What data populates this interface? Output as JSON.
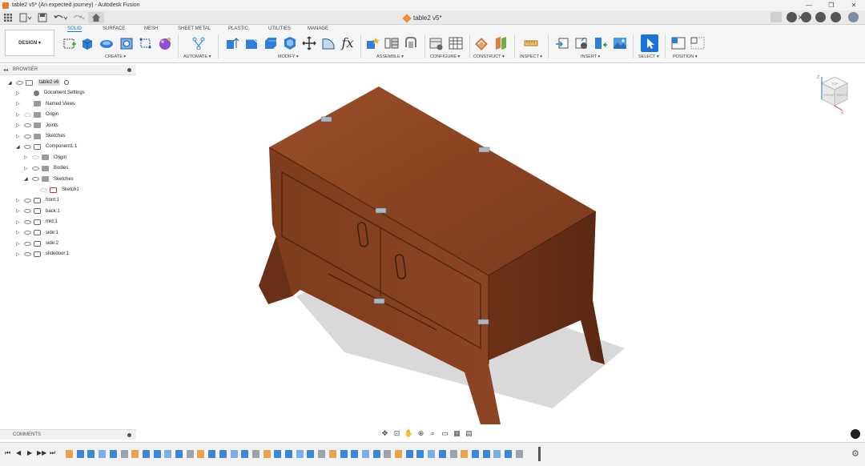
{
  "window": {
    "title": "table2 v5* (An expected journey) - Autodesk Fusion",
    "controls": [
      "—",
      "❐",
      "✕"
    ]
  },
  "quick_access": {
    "grid_icon": "apps-grid-icon",
    "file_icon": "file-menu-icon",
    "save_icon": "save-icon",
    "undo_icon": "undo-icon",
    "redo_icon": "redo-icon",
    "home_icon": "home-icon"
  },
  "document_tab": {
    "label": "table2 v5*",
    "close": "✕"
  },
  "ribbon": {
    "workspace": "DESIGN ▾",
    "tabs": [
      "SOLID",
      "SURFACE",
      "MESH",
      "SHEET METAL",
      "PLASTIC",
      "UTILITIES",
      "MANAGE"
    ],
    "active_tab": "SOLID",
    "groups": [
      "CREATE ▾",
      "AUTOMATE ▾",
      "MODIFY ▾",
      "ASSEMBLE ▾",
      "CONFIGURE ▾",
      "CONSTRUCT ▾",
      "INSPECT ▾",
      "INSERT ▾",
      "SELECT ▾",
      "POSITION ▾"
    ],
    "fx_label": "fx"
  },
  "browser": {
    "header": "BROWSER",
    "collapse": "◂◂",
    "items": [
      {
        "label": "table2 v6",
        "depth": 0,
        "expander": "◢",
        "icon": "document-icon",
        "eye": true,
        "root": true
      },
      {
        "label": "Document Settings",
        "depth": 1,
        "expander": "▷",
        "icon": "gear-icon",
        "eye": false
      },
      {
        "label": "Named Views",
        "depth": 1,
        "expander": "▷",
        "icon": "folder-icon",
        "eye": false
      },
      {
        "label": "Origin",
        "depth": 1,
        "expander": "▷",
        "icon": "folder-icon",
        "eye": true,
        "faint": true
      },
      {
        "label": "Joints",
        "depth": 1,
        "expander": "▷",
        "icon": "folder-icon",
        "eye": true
      },
      {
        "label": "Sketches",
        "depth": 1,
        "expander": "▷",
        "icon": "folder-icon",
        "eye": true
      },
      {
        "label": "Component1:1",
        "depth": 1,
        "expander": "◢",
        "icon": "component-icon",
        "eye": true
      },
      {
        "label": "Origin",
        "depth": 2,
        "expander": "▷",
        "icon": "folder-icon",
        "eye": true,
        "faint": true
      },
      {
        "label": "Bodies",
        "depth": 2,
        "expander": "▷",
        "icon": "folder-icon",
        "eye": true
      },
      {
        "label": "Sketches",
        "depth": 2,
        "expander": "◢",
        "icon": "folder-icon",
        "eye": true
      },
      {
        "label": "Sketch1",
        "depth": 3,
        "expander": "",
        "icon": "sketch-icon",
        "eye": true,
        "faint": true
      },
      {
        "label": "front:1",
        "depth": 1,
        "expander": "▷",
        "icon": "body-icon",
        "eye": true
      },
      {
        "label": "back:1",
        "depth": 1,
        "expander": "▷",
        "icon": "body-icon",
        "eye": true
      },
      {
        "label": "mid:1",
        "depth": 1,
        "expander": "▷",
        "icon": "body-icon",
        "eye": true
      },
      {
        "label": "side:1",
        "depth": 1,
        "expander": "▷",
        "icon": "body-icon",
        "eye": true
      },
      {
        "label": "side:2",
        "depth": 1,
        "expander": "▷",
        "icon": "body-icon",
        "eye": true
      },
      {
        "label": "slidedoor:1",
        "depth": 1,
        "expander": "▷",
        "icon": "body-icon",
        "eye": true
      }
    ]
  },
  "comments": {
    "label": "COMMENTS"
  },
  "viewcube": {
    "top": "TOP",
    "front": "FRONT",
    "right": "RIGHT",
    "z": "Z",
    "x": "X",
    "y": "Y"
  },
  "nav_bar": [
    "✥",
    "⊡",
    "✋",
    "⊕",
    "⌕",
    "▭",
    "▦",
    "▤"
  ],
  "timeline": {
    "controls": [
      "⏮",
      "◀",
      "▶",
      "▶▶",
      "⏭"
    ],
    "feature_count": 42,
    "settings_icon": "⚙"
  },
  "colors": {
    "accent": "#1a73d9",
    "wood": "#8a4322",
    "wood_dark": "#5e2b15",
    "shadow": "#cfcfcf"
  }
}
